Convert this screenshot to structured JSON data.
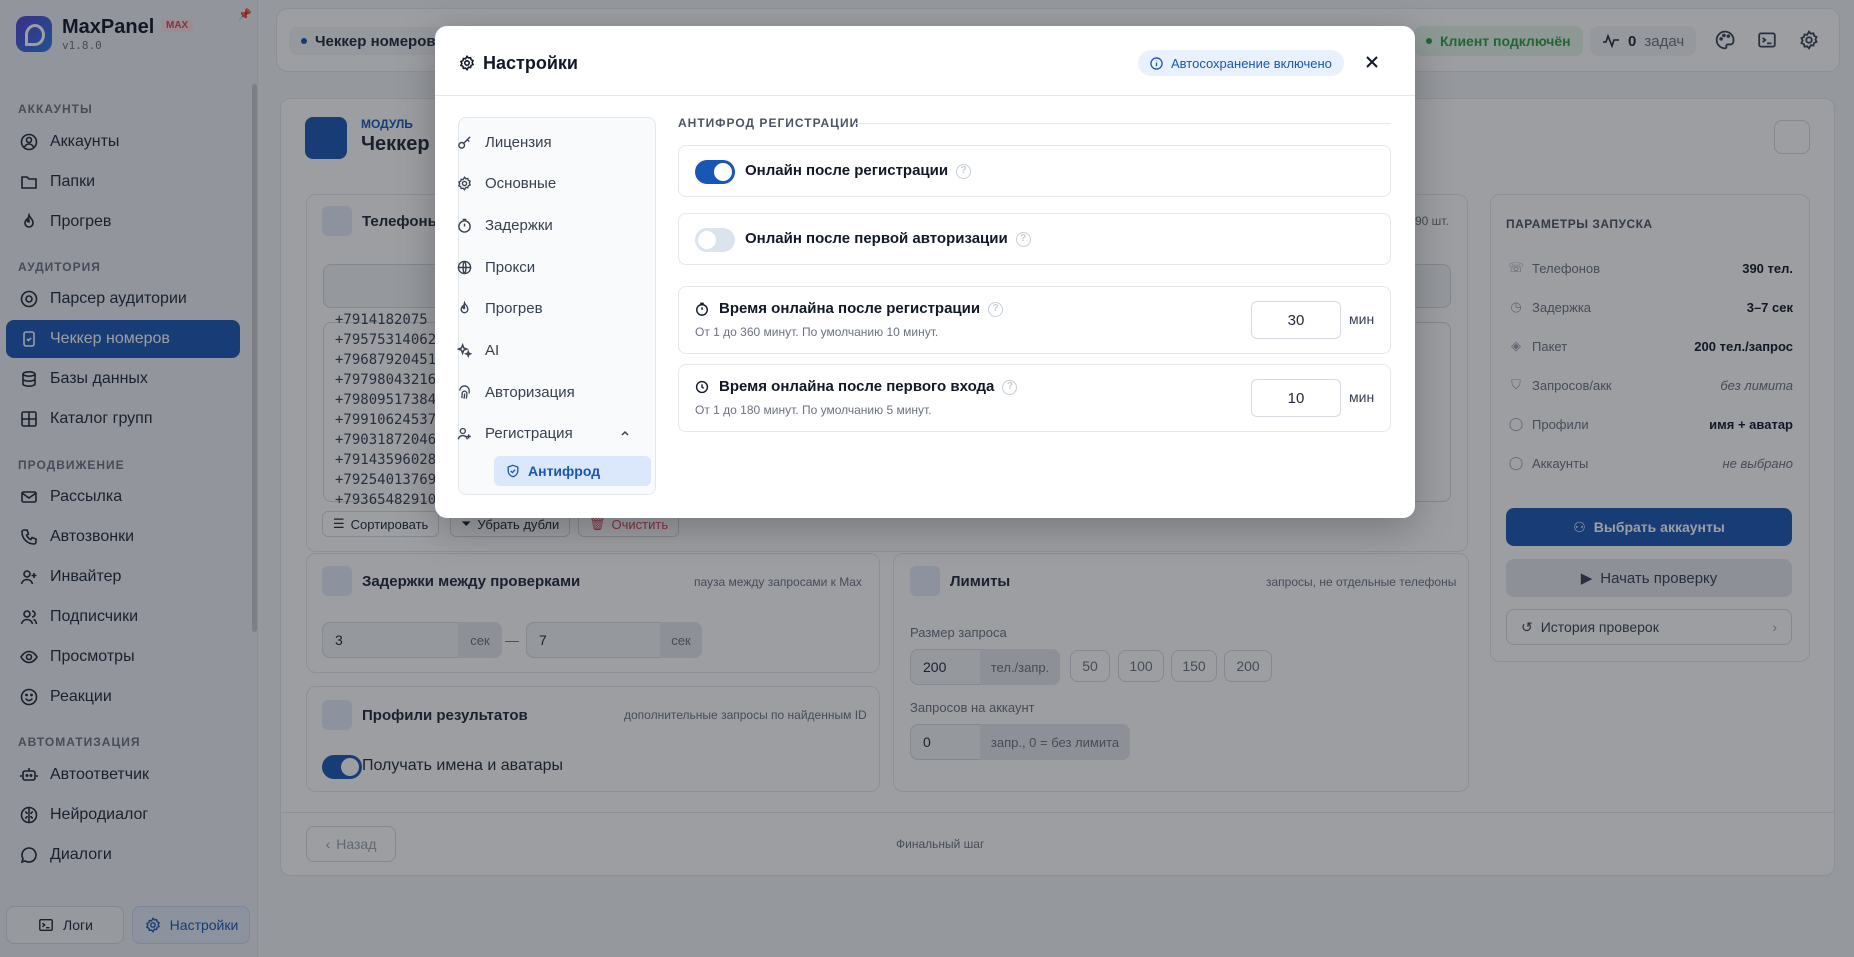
{
  "app": {
    "name": "MaxPanel",
    "badge": "MAX",
    "version": "v1.8.0"
  },
  "sidebar": {
    "sections": [
      {
        "title": "АККАУНТЫ",
        "items": [
          {
            "label": "Аккаунты"
          },
          {
            "label": "Папки"
          },
          {
            "label": "Прогрев"
          }
        ]
      },
      {
        "title": "АУДИТОРИЯ",
        "items": [
          {
            "label": "Парсер аудитории"
          },
          {
            "label": "Чеккер номеров"
          },
          {
            "label": "Базы данных"
          },
          {
            "label": "Каталог групп"
          }
        ]
      },
      {
        "title": "ПРОДВИЖЕНИЕ",
        "items": [
          {
            "label": "Рассылка"
          },
          {
            "label": "Автозвонки"
          },
          {
            "label": "Инвайтер"
          },
          {
            "label": "Подписчики"
          },
          {
            "label": "Просмотры"
          },
          {
            "label": "Реакции"
          }
        ]
      },
      {
        "title": "АВТОМАТИЗАЦИЯ",
        "items": [
          {
            "label": "Автоответчик"
          },
          {
            "label": "Нейродиалог"
          },
          {
            "label": "Диалоги"
          }
        ]
      }
    ],
    "footer": {
      "logs": "Логи",
      "settings": "Настройки"
    }
  },
  "topbar": {
    "chip": "Чеккер номеров",
    "connected": "Клиент подключён",
    "tasks_count": "0",
    "tasks_label": "задач"
  },
  "page": {
    "module_label": "МОДУЛЬ",
    "module_title": "Чеккер н",
    "phones_card_title": "Телефоны д",
    "phones_count": "90 шт.",
    "phones": [
      "+7914182075",
      "+79575314062",
      "+79687920451",
      "+79798043216",
      "+79809517384",
      "+79910624537",
      "+79031872046",
      "+79143596028",
      "+79254013769",
      "+79365482910"
    ],
    "buttons": {
      "sort": "Сортировать",
      "dedupe": "Убрать дубли",
      "clear": "Очистить"
    },
    "delays": {
      "title": "Задержки между проверками",
      "hint": "пауза между запросами к Max",
      "from": "3",
      "to": "7",
      "unit": "сек",
      "dash": "—"
    },
    "limits": {
      "title": "Лимиты",
      "hint": "запросы, не отдельные телефоны",
      "size_label": "Размер запроса",
      "size_value": "200",
      "size_unit": "тел./запр.",
      "presets": [
        "50",
        "100",
        "150",
        "200"
      ],
      "per_acc_label": "Запросов на аккаунт",
      "per_acc_value": "0",
      "per_acc_unit": "запр., 0 = без лимита"
    },
    "profiles": {
      "title": "Профили результатов",
      "hint": "дополнительные запросы по найденным ID",
      "toggle_label": "Получать имена и аватары"
    },
    "params": {
      "title": "ПАРАМЕТРЫ ЗАПУСКА",
      "rows": [
        {
          "label": "Телефонов",
          "value": "390 тел."
        },
        {
          "label": "Задержка",
          "value": "3–7 сек"
        },
        {
          "label": "Пакет",
          "value": "200 тел./запрос"
        },
        {
          "label": "Запросов/акк",
          "value": "без лимита"
        },
        {
          "label": "Профили",
          "value": "имя + аватар"
        },
        {
          "label": "Аккаунты",
          "value": "не выбрано"
        }
      ],
      "select_accounts": "Выбрать аккаунты",
      "start": "Начать проверку",
      "history": "История проверок"
    },
    "footer": {
      "back": "Назад",
      "step": "Финальный шаг"
    }
  },
  "modal": {
    "title": "Настройки",
    "autosave": "Автосохранение включено",
    "nav": [
      {
        "label": "Лицензия"
      },
      {
        "label": "Основные"
      },
      {
        "label": "Задержки"
      },
      {
        "label": "Прокси"
      },
      {
        "label": "Прогрев"
      },
      {
        "label": "AI"
      },
      {
        "label": "Авторизация"
      },
      {
        "label": "Регистрация"
      }
    ],
    "sub_active": "Антифрод",
    "section_title": "АНТИФРОД РЕГИСТРАЦИИ",
    "toggles": [
      {
        "label": "Онлайн после регистрации",
        "on": true
      },
      {
        "label": "Онлайн после первой авторизации",
        "on": false
      }
    ],
    "fields": [
      {
        "label": "Время онлайна после регистрации",
        "hint": "От 1 до 360 минут. По умолчанию 10 минут.",
        "value": "30",
        "unit": "мин"
      },
      {
        "label": "Время онлайна после первого входа",
        "hint": "От 1 до 180 минут. По умолчанию 5 минут.",
        "value": "10",
        "unit": "мин"
      }
    ]
  }
}
